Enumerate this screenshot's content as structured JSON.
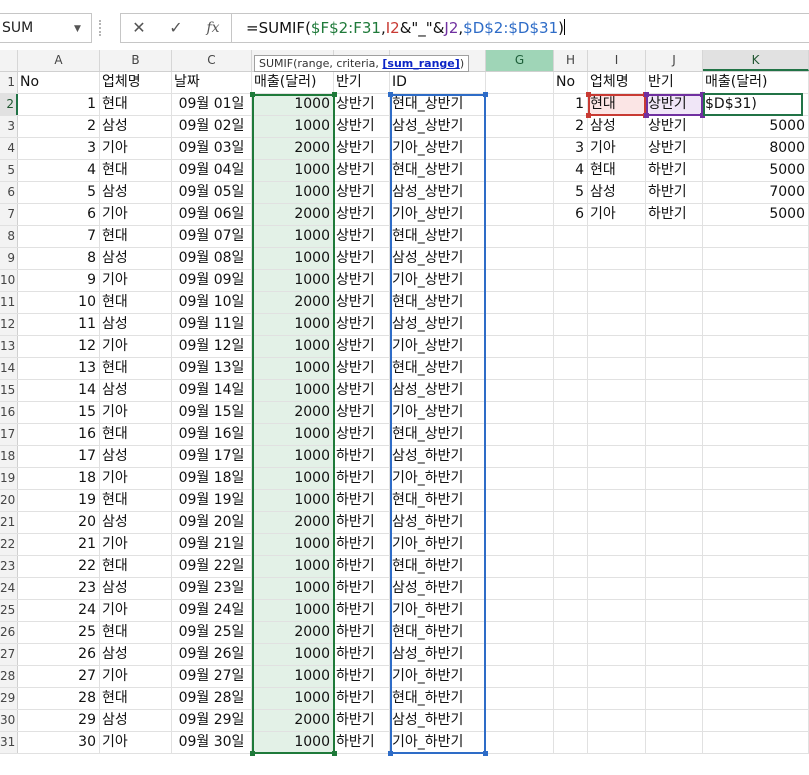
{
  "formula_bar": {
    "name_box": "SUM",
    "cancel_icon": "✕",
    "enter_icon": "✓",
    "fx_icon": "fx",
    "formula_parts": [
      "=SUMIF(",
      "$F$2:F31",
      ",",
      "I2",
      "&\"_\"&",
      "J2",
      ",",
      "$D$2:$D$31",
      ")"
    ]
  },
  "tooltip": {
    "prefix": "SUMIF(range, criteria, ",
    "arg": "[sum_range]",
    "suffix": ")"
  },
  "colors": {
    "range_f": "#1f7a3a",
    "criteria_i": "#c83a33",
    "criteria_j": "#7030a0",
    "sum_range_d": "#2e6cc7",
    "selection": "#217346"
  },
  "column_headers": [
    "A",
    "B",
    "C",
    "D",
    "E",
    "F",
    "G",
    "H",
    "I",
    "J",
    "K"
  ],
  "row_headers": [
    "1",
    "2",
    "3",
    "4",
    "5",
    "6",
    "7",
    "8",
    "9",
    "10",
    "11",
    "12",
    "13",
    "14",
    "15",
    "16",
    "17",
    "18",
    "19",
    "20",
    "21",
    "22",
    "23",
    "24",
    "25",
    "26",
    "27",
    "28",
    "29",
    "30",
    "31"
  ],
  "left_table": {
    "headers": {
      "no": "No",
      "company": "업체명",
      "date": "날짜",
      "sales": "매출(달러)",
      "half": "반기",
      "id": "ID"
    },
    "rows": [
      {
        "no": "1",
        "company": "현대",
        "date": "09월 01일",
        "sales": "1000",
        "half": "상반기",
        "id": "현대_상반기"
      },
      {
        "no": "2",
        "company": "삼성",
        "date": "09월 02일",
        "sales": "1000",
        "half": "상반기",
        "id": "삼성_상반기"
      },
      {
        "no": "3",
        "company": "기아",
        "date": "09월 03일",
        "sales": "2000",
        "half": "상반기",
        "id": "기아_상반기"
      },
      {
        "no": "4",
        "company": "현대",
        "date": "09월 04일",
        "sales": "1000",
        "half": "상반기",
        "id": "현대_상반기"
      },
      {
        "no": "5",
        "company": "삼성",
        "date": "09월 05일",
        "sales": "1000",
        "half": "상반기",
        "id": "삼성_상반기"
      },
      {
        "no": "6",
        "company": "기아",
        "date": "09월 06일",
        "sales": "2000",
        "half": "상반기",
        "id": "기아_상반기"
      },
      {
        "no": "7",
        "company": "현대",
        "date": "09월 07일",
        "sales": "1000",
        "half": "상반기",
        "id": "현대_상반기"
      },
      {
        "no": "8",
        "company": "삼성",
        "date": "09월 08일",
        "sales": "1000",
        "half": "상반기",
        "id": "삼성_상반기"
      },
      {
        "no": "9",
        "company": "기아",
        "date": "09월 09일",
        "sales": "1000",
        "half": "상반기",
        "id": "기아_상반기"
      },
      {
        "no": "10",
        "company": "현대",
        "date": "09월 10일",
        "sales": "2000",
        "half": "상반기",
        "id": "현대_상반기"
      },
      {
        "no": "11",
        "company": "삼성",
        "date": "09월 11일",
        "sales": "1000",
        "half": "상반기",
        "id": "삼성_상반기"
      },
      {
        "no": "12",
        "company": "기아",
        "date": "09월 12일",
        "sales": "1000",
        "half": "상반기",
        "id": "기아_상반기"
      },
      {
        "no": "13",
        "company": "현대",
        "date": "09월 13일",
        "sales": "1000",
        "half": "상반기",
        "id": "현대_상반기"
      },
      {
        "no": "14",
        "company": "삼성",
        "date": "09월 14일",
        "sales": "1000",
        "half": "상반기",
        "id": "삼성_상반기"
      },
      {
        "no": "15",
        "company": "기아",
        "date": "09월 15일",
        "sales": "2000",
        "half": "상반기",
        "id": "기아_상반기"
      },
      {
        "no": "16",
        "company": "현대",
        "date": "09월 16일",
        "sales": "1000",
        "half": "상반기",
        "id": "현대_상반기"
      },
      {
        "no": "17",
        "company": "삼성",
        "date": "09월 17일",
        "sales": "1000",
        "half": "하반기",
        "id": "삼성_하반기"
      },
      {
        "no": "18",
        "company": "기아",
        "date": "09월 18일",
        "sales": "1000",
        "half": "하반기",
        "id": "기아_하반기"
      },
      {
        "no": "19",
        "company": "현대",
        "date": "09월 19일",
        "sales": "1000",
        "half": "하반기",
        "id": "현대_하반기"
      },
      {
        "no": "20",
        "company": "삼성",
        "date": "09월 20일",
        "sales": "2000",
        "half": "하반기",
        "id": "삼성_하반기"
      },
      {
        "no": "21",
        "company": "기아",
        "date": "09월 21일",
        "sales": "1000",
        "half": "하반기",
        "id": "기아_하반기"
      },
      {
        "no": "22",
        "company": "현대",
        "date": "09월 22일",
        "sales": "1000",
        "half": "하반기",
        "id": "현대_하반기"
      },
      {
        "no": "23",
        "company": "삼성",
        "date": "09월 23일",
        "sales": "1000",
        "half": "하반기",
        "id": "삼성_하반기"
      },
      {
        "no": "24",
        "company": "기아",
        "date": "09월 24일",
        "sales": "1000",
        "half": "하반기",
        "id": "기아_하반기"
      },
      {
        "no": "25",
        "company": "현대",
        "date": "09월 25일",
        "sales": "2000",
        "half": "하반기",
        "id": "현대_하반기"
      },
      {
        "no": "26",
        "company": "삼성",
        "date": "09월 26일",
        "sales": "1000",
        "half": "하반기",
        "id": "삼성_하반기"
      },
      {
        "no": "27",
        "company": "기아",
        "date": "09월 27일",
        "sales": "1000",
        "half": "하반기",
        "id": "기아_하반기"
      },
      {
        "no": "28",
        "company": "현대",
        "date": "09월 28일",
        "sales": "1000",
        "half": "하반기",
        "id": "현대_하반기"
      },
      {
        "no": "29",
        "company": "삼성",
        "date": "09월 29일",
        "sales": "2000",
        "half": "하반기",
        "id": "삼성_하반기"
      },
      {
        "no": "30",
        "company": "기아",
        "date": "09월 30일",
        "sales": "1000",
        "half": "하반기",
        "id": "기아_하반기"
      }
    ]
  },
  "right_table": {
    "headers": {
      "no": "No",
      "company": "업체명",
      "half": "반기",
      "sales": "매출(달러)"
    },
    "rows": [
      {
        "no": "1",
        "company": "현대",
        "half": "상반기",
        "sales": "$D$31)"
      },
      {
        "no": "2",
        "company": "삼성",
        "half": "상반기",
        "sales": "5000"
      },
      {
        "no": "3",
        "company": "기아",
        "half": "상반기",
        "sales": "8000"
      },
      {
        "no": "4",
        "company": "현대",
        "half": "하반기",
        "sales": "5000"
      },
      {
        "no": "5",
        "company": "삼성",
        "half": "하반기",
        "sales": "7000"
      },
      {
        "no": "6",
        "company": "기아",
        "half": "하반기",
        "sales": "5000"
      }
    ]
  }
}
